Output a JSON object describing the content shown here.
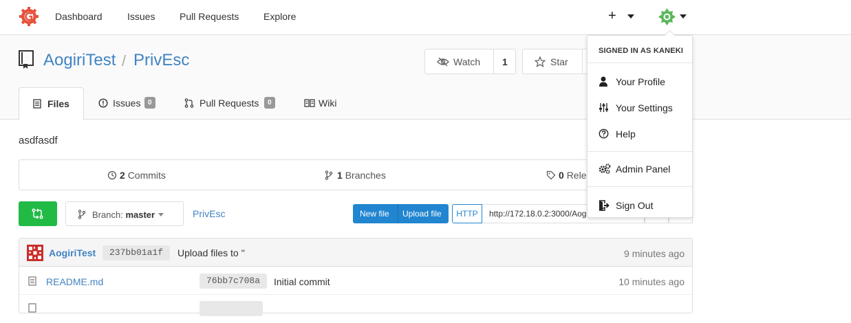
{
  "nav": {
    "links": [
      "Dashboard",
      "Issues",
      "Pull Requests",
      "Explore"
    ],
    "plus_label": "+"
  },
  "repo": {
    "owner": "AogiriTest",
    "separator": "/",
    "name": "PrivEsc",
    "watch_label": "Watch",
    "watch_count": "1",
    "star_label": "Star",
    "description": "asdfasdf"
  },
  "tabs": [
    {
      "label": "Files",
      "badge": ""
    },
    {
      "label": "Issues",
      "badge": "0"
    },
    {
      "label": "Pull Requests",
      "badge": "0"
    },
    {
      "label": "Wiki",
      "badge": ""
    }
  ],
  "stats": {
    "commits_count": "2",
    "commits_label": "Commits",
    "branches_count": "1",
    "branches_label": "Branches",
    "releases_count": "0",
    "releases_label": "Rele"
  },
  "actions": {
    "branch_prefix": "Branch:",
    "branch_name": "master",
    "breadcrumb": "PrivEsc",
    "new_file": "New file",
    "upload_file": "Upload file",
    "http_label": "HTTP",
    "clone_url": "http://172.18.0.2:3000/Aogi"
  },
  "latest_commit": {
    "author": "AogiriTest",
    "sha": "237bb01a1f",
    "message": "Upload files to ''",
    "age": "9 minutes ago"
  },
  "files": [
    {
      "name": "README.md",
      "sha": "76bb7c708a",
      "message": "Initial commit",
      "age": "10 minutes ago"
    }
  ],
  "user_menu": {
    "header": "SIGNED IN AS KANEKI",
    "items": [
      "Your Profile",
      "Your Settings",
      "Help",
      "Admin Panel",
      "Sign Out"
    ]
  },
  "colors": {
    "brand": "#e5533d",
    "link": "#4183c4",
    "green": "#21ba45",
    "blue": "#2185d0",
    "avatar": "#5cb85c"
  }
}
